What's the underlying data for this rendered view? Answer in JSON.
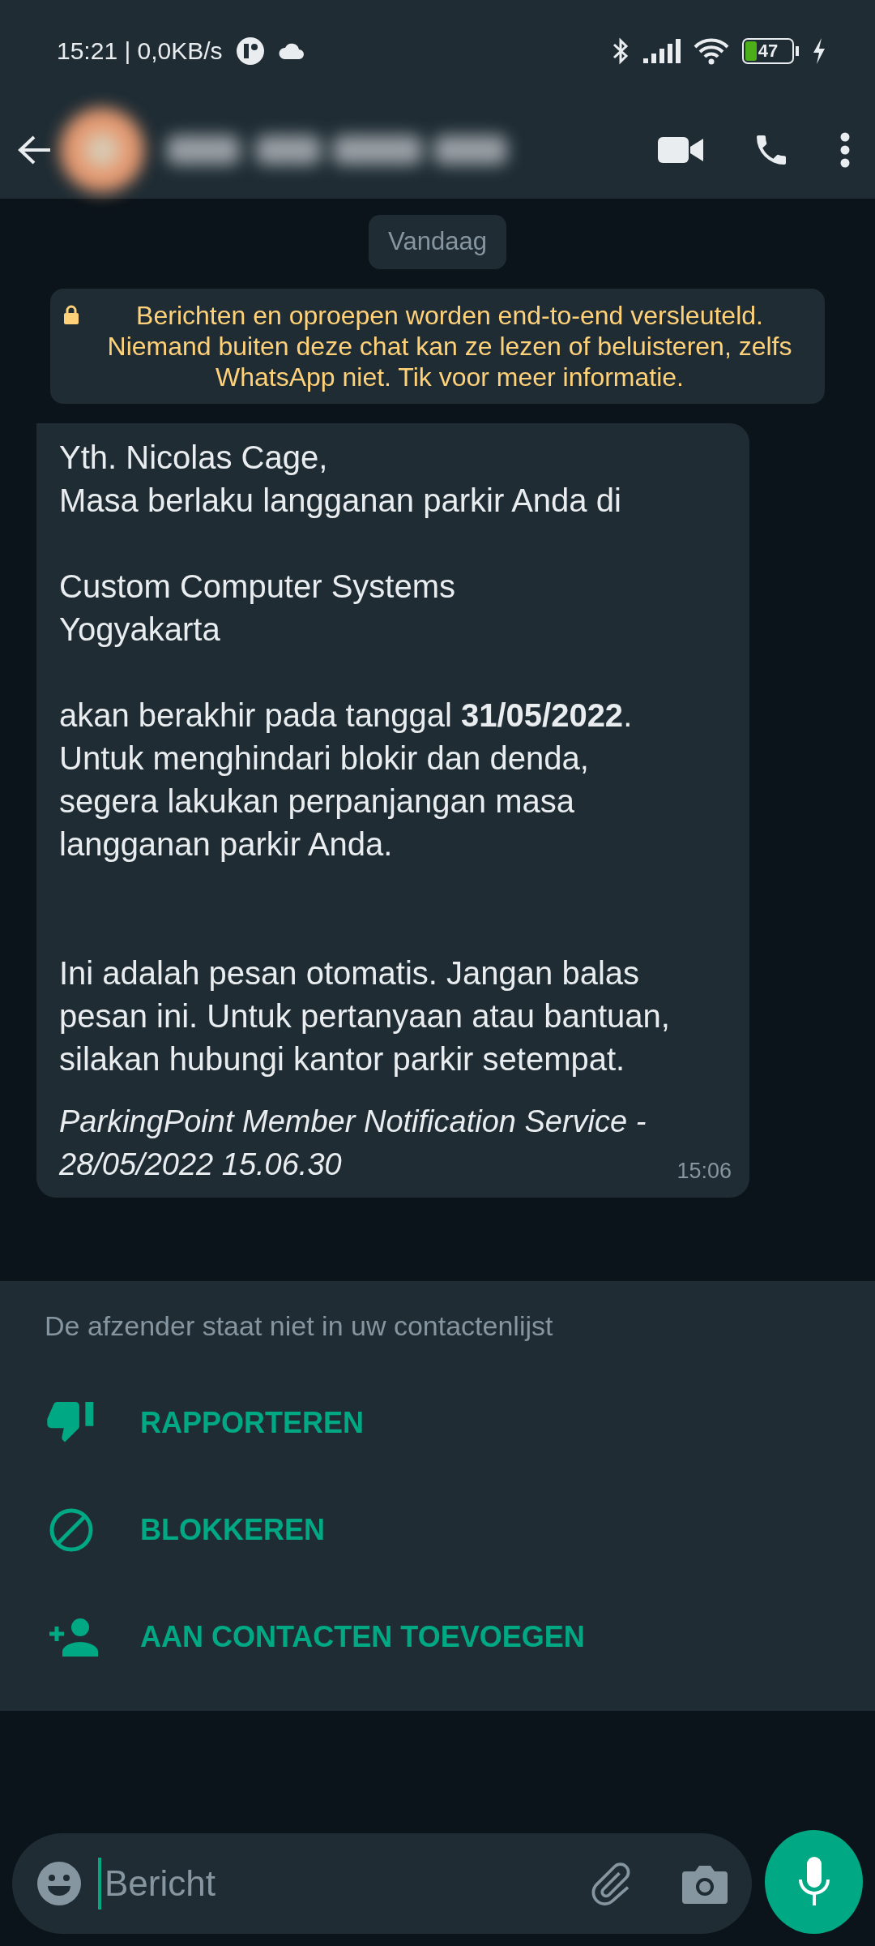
{
  "status_bar": {
    "time_speed": "15:21 | 0,0KB/s",
    "battery": "47",
    "charging": true
  },
  "header": {
    "contact_hidden": true
  },
  "date_chip": "Vandaag",
  "encryption_notice": "Berichten en oproepen worden end-to-end versleuteld. Niemand buiten deze chat kan ze lezen of beluisteren, zelfs WhatsApp niet. Tik voor meer informatie.",
  "message": {
    "body": "Yth. Nicolas Cage,\nMasa berlaku langganan parkir Anda di\n\nCustom Computer Systems\nYogyakarta\n\nakan berakhir pada tanggal **31/05/2022**.\nUntuk menghindari blokir dan denda,\nsegera lakukan perpanjangan masa\nlangganan parkir Anda.\n\n\nIni adalah pesan otomatis. Jangan balas\npesan ini. Untuk pertanyaan atau bantuan,\nsilakan hubungi kantor parkir setempat.",
    "signature": "ParkingPoint Member Notification Service -\n28/05/2022 15.06.30",
    "time": "15:06"
  },
  "unknown_sender": {
    "notice": "De afzender staat niet in uw contactenlijst",
    "actions": [
      {
        "kind": "report",
        "label": "RAPPORTEREN"
      },
      {
        "kind": "block",
        "label": "BLOKKEREN"
      },
      {
        "kind": "add",
        "label": "AAN CONTACTEN TOEVOEGEN"
      }
    ]
  },
  "composer": {
    "placeholder": "Bericht"
  }
}
